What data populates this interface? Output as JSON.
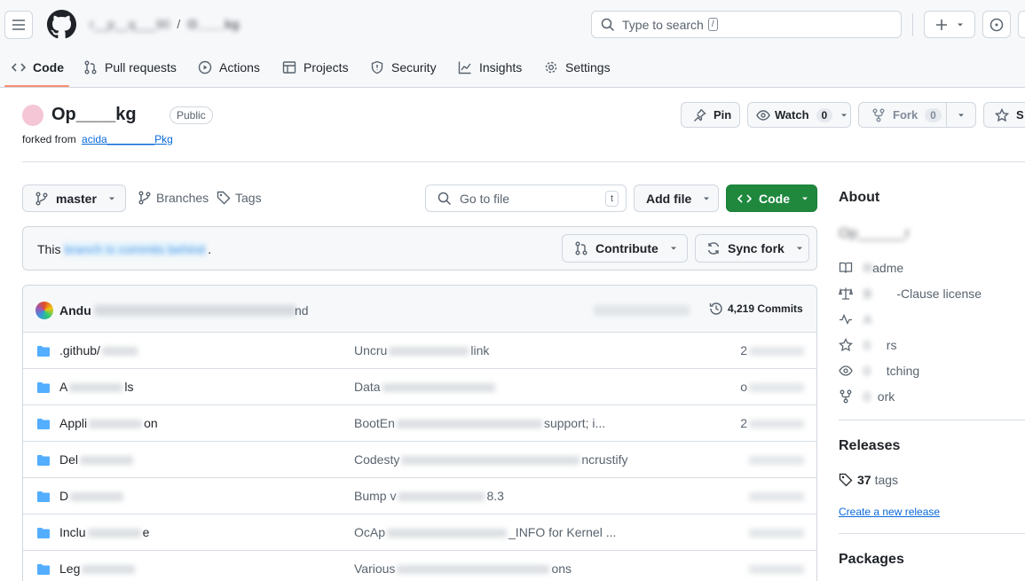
{
  "header": {
    "owner": "r__p__q___90",
    "separator": "/",
    "repo": "O____kg",
    "search_placeholder": "Type to search",
    "search_key": "/",
    "tabs": [
      {
        "label": "Code",
        "icon": "code-icon"
      },
      {
        "label": "Pull requests",
        "icon": "pull-request-icon"
      },
      {
        "label": "Actions",
        "icon": "play-icon"
      },
      {
        "label": "Projects",
        "icon": "table-icon"
      },
      {
        "label": "Security",
        "icon": "shield-icon"
      },
      {
        "label": "Insights",
        "icon": "graph-icon"
      },
      {
        "label": "Settings",
        "icon": "gear-icon"
      }
    ]
  },
  "repo": {
    "title": "Op____kg",
    "visibility": "Public",
    "forked_from_label": "forked from",
    "forked_from_link": "acida________Pkg",
    "pin_label": "Pin",
    "watch_label": "Watch",
    "watch_count": "0",
    "fork_label": "Fork",
    "fork_count": "0",
    "star_label": "S"
  },
  "toolbar": {
    "branch": "master",
    "branches_label": "Branches",
    "tags_label": "Tags",
    "goto_placeholder": "Go to file",
    "goto_key": "t",
    "add_file_label": "Add file",
    "code_label": "Code"
  },
  "banner": {
    "text_start": "This",
    "text_blurred": "branch is commits behind",
    "text_end": ".",
    "contribute_label": "Contribute",
    "sync_label": "Sync fork"
  },
  "commit": {
    "author": "Andu",
    "message_end": "nd",
    "commits_label": "4,219 Commits"
  },
  "files": [
    {
      "name": ".github/",
      "message": "Uncru",
      "message_tail": "link",
      "date": "2"
    },
    {
      "name": "A",
      "name_tail": "ls",
      "message": "Data",
      "message_tail": "",
      "date": "o"
    },
    {
      "name": "Appli",
      "name_tail": "on",
      "message": "BootEn",
      "message_tail": "support; i...",
      "date": "2"
    },
    {
      "name": "Del",
      "name_tail": "",
      "message": "Codesty",
      "message_tail": "ncrustify",
      "date": ""
    },
    {
      "name": "D",
      "name_tail": "",
      "message": "Bump v",
      "message_tail": "8.3",
      "date": ""
    },
    {
      "name": "Inclu",
      "name_tail": "e",
      "message": "OcAp",
      "message_tail": "_INFO for Kernel ...",
      "date": ""
    },
    {
      "name": "Leg",
      "name_tail": "",
      "message": "Various",
      "message_tail": "ons",
      "date": ""
    }
  ],
  "about": {
    "heading": "About",
    "description": "Op______r",
    "items": [
      {
        "icon": "book-icon",
        "label": "R",
        "tail": "adme"
      },
      {
        "icon": "law-icon",
        "label": "B",
        "tail": "-Clause license"
      },
      {
        "icon": "pulse-icon",
        "label": "A",
        "tail": ""
      },
      {
        "icon": "star-icon",
        "label": "0",
        "tail": "rs"
      },
      {
        "icon": "eye-icon",
        "label": "0",
        "tail": "tching"
      },
      {
        "icon": "fork-icon",
        "label": "0",
        "tail": "ork"
      }
    ]
  },
  "releases": {
    "heading": "Releases",
    "tags_count": "37",
    "tags_label": "tags",
    "create_link": "Create a new release"
  },
  "packages": {
    "heading": "Packages"
  },
  "colors": {
    "accent": "#0969da",
    "primary_button": "#1f883d",
    "border": "#d0d7de",
    "tab_underline": "#fd8c73"
  }
}
